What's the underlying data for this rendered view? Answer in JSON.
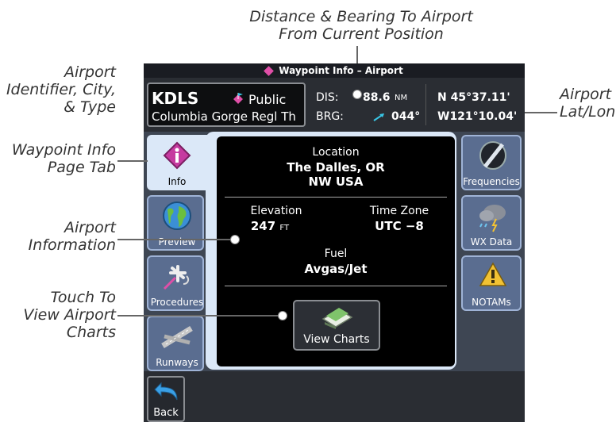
{
  "callouts": {
    "top": [
      "Distance & Bearing To Airport",
      "From Current Position"
    ],
    "identifier": [
      "Airport",
      "Identifier, City,",
      "& Type"
    ],
    "latlon": [
      "Airport",
      "Lat/Lon"
    ],
    "info_tab": [
      "Waypoint Info",
      "Page Tab"
    ],
    "airport_info": [
      "Airport",
      "Information"
    ],
    "charts": [
      "Touch To",
      "View Airport",
      "Charts"
    ]
  },
  "title": "Waypoint Info – Airport",
  "header": {
    "ident": "KDLS",
    "type": "Public",
    "name": "Columbia Gorge Regl Th",
    "dis_label": "DIS:",
    "dis_value": "88.6",
    "dis_unit": "NM",
    "brg_label": "BRG:",
    "brg_value": "044°",
    "lat": "N 45°37.11'",
    "lon": "W121°10.04'"
  },
  "left_tabs": [
    {
      "label": "Info",
      "icon": "info-diamond-icon",
      "active": true
    },
    {
      "label": "Preview",
      "icon": "globe-icon"
    },
    {
      "label": "Procedures",
      "icon": "airplane-procedure-icon"
    },
    {
      "label": "Runways",
      "icon": "runway-icon"
    }
  ],
  "right_tabs": [
    {
      "label": "Frequencies",
      "icon": "frequencies-icon"
    },
    {
      "label": "WX Data",
      "icon": "weather-cloud-icon"
    },
    {
      "label": "NOTAMs",
      "icon": "notam-warning-icon"
    }
  ],
  "info": {
    "location_label": "Location",
    "location_city": "The Dalles, OR",
    "location_region": "NW USA",
    "elevation_label": "Elevation",
    "elevation_value": "247",
    "elevation_unit": "FT",
    "timezone_label": "Time Zone",
    "timezone_value": "UTC −8",
    "fuel_label": "Fuel",
    "fuel_value": "Avgas/Jet"
  },
  "charts_button": "View Charts",
  "back_button": "Back",
  "colors": {
    "accent_active_tab": "#dbe8f8",
    "tab_blue": "#5a6d90",
    "airport_magenta": "#e04fa8",
    "bearing_cyan": "#39c6e6"
  }
}
